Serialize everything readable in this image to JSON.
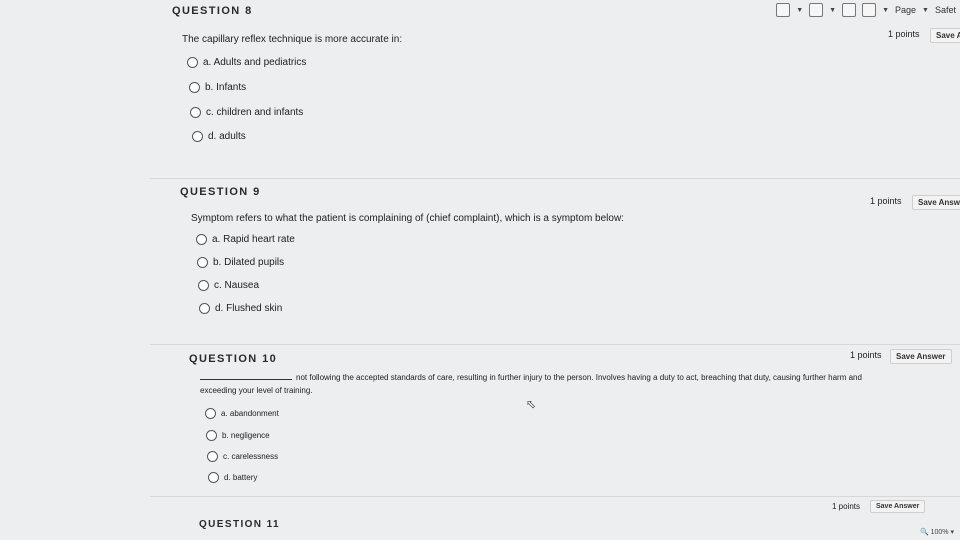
{
  "toolbar": {
    "page_label": "Page",
    "safety_label": "Safet"
  },
  "q8": {
    "title": "QUESTION 8",
    "text": "The capillary reflex technique is more accurate in:",
    "points": "1 points",
    "save": "Save A",
    "options": [
      "a. Adults and pediatrics",
      "b. Infants",
      "c. children and infants",
      "d. adults"
    ]
  },
  "q9": {
    "title": "QUESTION 9",
    "text": "Symptom refers to what the patient is complaining of (chief complaint), which is a symptom below:",
    "points": "1 points",
    "save": "Save Answe",
    "options": [
      "a. Rapid heart rate",
      "b. Dilated pupils",
      "c. Nausea",
      "d. Flushed skin"
    ]
  },
  "q10": {
    "title": "QUESTION 10",
    "text_line1": "not following the accepted standards of care, resulting in further injury to the person. Involves having a duty to act, breaching that duty, causing further harm and",
    "text_line2": "exceeding your level of training.",
    "points": "1 points",
    "save": "Save Answer",
    "options": [
      "a. abandonment",
      "b. negligence",
      "c. carelessness",
      "d. battery"
    ]
  },
  "q11": {
    "title": "QUESTION 11",
    "points": "1 points",
    "save": "Save Answer"
  },
  "status": {
    "zoom": "100%"
  }
}
